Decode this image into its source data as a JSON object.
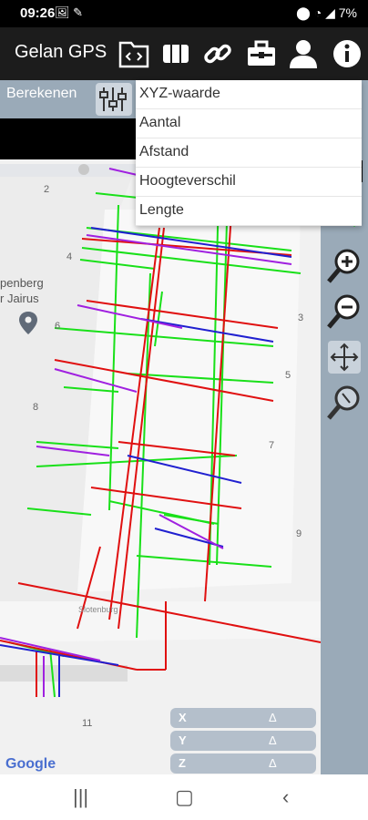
{
  "status_bar": {
    "time": "09:26",
    "battery": "7%"
  },
  "app": {
    "title": "Gelan GPS"
  },
  "toolbar": [
    "code-folder-icon",
    "map-book-icon",
    "link-icon",
    "toolbox-icon",
    "user-icon",
    "info-icon"
  ],
  "calc_bar": {
    "label": "Berekenen"
  },
  "dropdown": {
    "items": [
      "XYZ-waarde",
      "Aantal",
      "Afstand",
      "Hoogteverschil",
      "Lengte"
    ]
  },
  "map": {
    "house_numbers": [
      "2",
      "4",
      "6",
      "8",
      "3",
      "5",
      "7",
      "9",
      "11"
    ],
    "poi_label_line1": "penberg",
    "poi_label_line2": "r Jairus",
    "street_name": "Slotenburg",
    "attribution": "Google"
  },
  "coords": [
    {
      "label": "X",
      "delta": "Δ"
    },
    {
      "label": "Y",
      "delta": "Δ"
    },
    {
      "label": "Z",
      "delta": "Δ"
    }
  ],
  "colors": {
    "red": "#e01010",
    "green": "#19e019",
    "blue": "#2020d0",
    "purple": "#a020e0",
    "panel": "#9aaab8"
  }
}
